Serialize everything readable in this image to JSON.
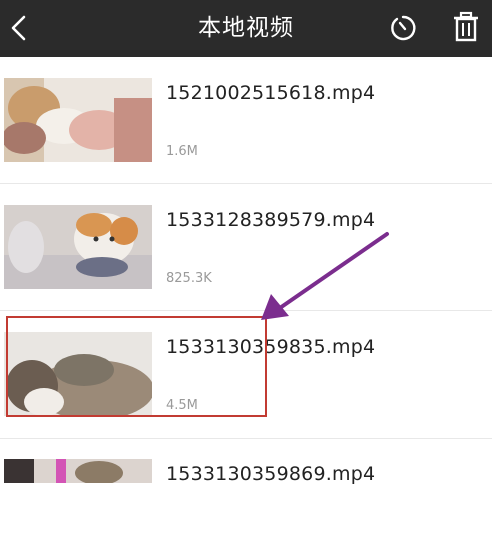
{
  "header": {
    "title": "本地视频",
    "back_icon": "chevron-left-icon",
    "refresh_icon": "refresh-icon",
    "delete_icon": "trash-icon",
    "background": "#2b2b2b"
  },
  "videos": [
    {
      "name": "1521002515618.mp4",
      "size": "1.6M"
    },
    {
      "name": "1533128389579.mp4",
      "size": "825.3K"
    },
    {
      "name": "1533130359835.mp4",
      "size": "4.5M"
    },
    {
      "name": "1533130359869.mp4",
      "size": ""
    }
  ],
  "annotation": {
    "highlight_color": "#c23b32",
    "arrow_color": "#7b2d8e"
  }
}
